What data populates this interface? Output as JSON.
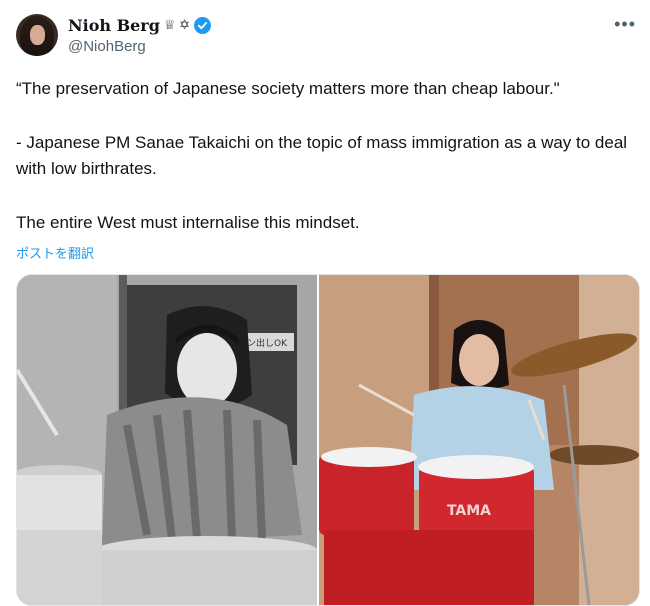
{
  "author": {
    "display_name": "Nioh Berg",
    "name_emojis": "♕ ✡",
    "handle": "@NiohBerg"
  },
  "tweet": {
    "paragraphs": [
      "“The preservation of Japanese society matters more than cheap labour.\"",
      "- Japanese PM Sanae Takaichi on the topic of mass immigration as a way to deal with low birthrates.",
      "The entire West must internalise this mindset."
    ],
    "translate_link": "ポストを翻訳"
  },
  "media": {
    "left_sign_text": "ライン出しOK",
    "right_drum_text": "TAMA"
  },
  "icons": {
    "more": "more-horizontal-icon",
    "verified": "verified-badge-icon"
  },
  "colors": {
    "accent": "#1d9bf0",
    "text": "#0f1419",
    "secondary": "#536471"
  }
}
